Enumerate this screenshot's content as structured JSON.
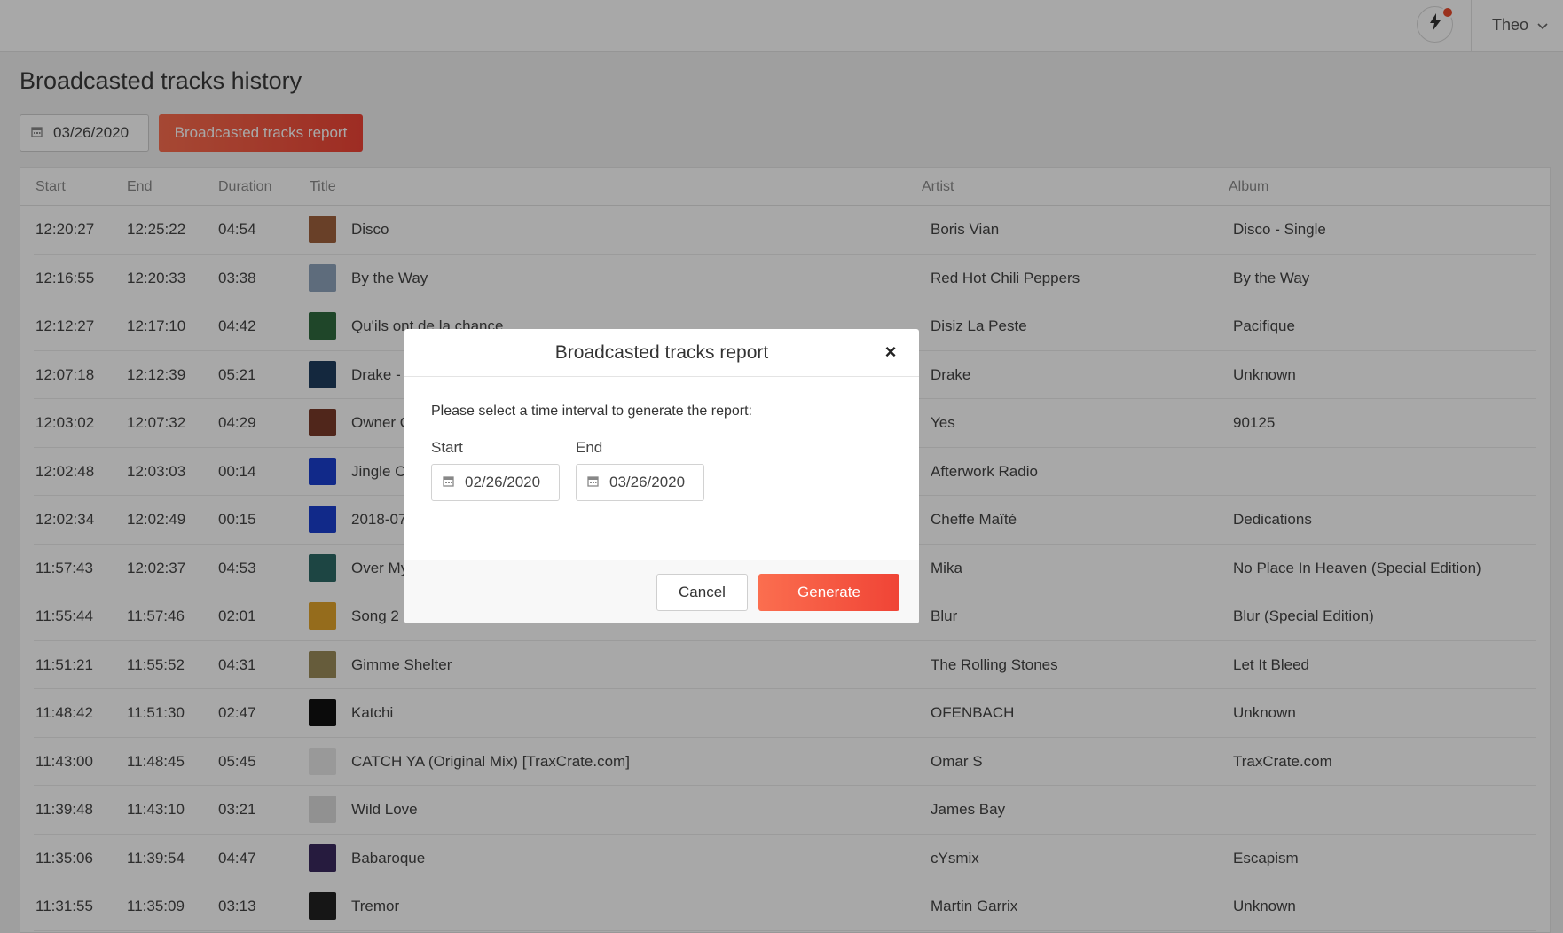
{
  "topbar": {
    "notifications_icon": "lightning-bolt-icon",
    "user_name": "Theo",
    "user_menu_icon": "chevron-down-icon"
  },
  "page": {
    "title": "Broadcasted tracks history",
    "date_filter": "03/26/2020",
    "report_button": "Broadcasted tracks report"
  },
  "table": {
    "headers": {
      "start": "Start",
      "end": "End",
      "duration": "Duration",
      "title": "Title",
      "artist": "Artist",
      "album": "Album"
    },
    "rows": [
      {
        "start": "12:20:27",
        "end": "12:25:22",
        "duration": "04:54",
        "title": "Disco",
        "artist": "Boris Vian",
        "album": "Disco - Single",
        "cover": "#a0623e"
      },
      {
        "start": "12:16:55",
        "end": "12:20:33",
        "duration": "03:38",
        "title": "By the Way",
        "artist": "Red Hot Chili Peppers",
        "album": "By the Way",
        "cover": "#8fa5bd"
      },
      {
        "start": "12:12:27",
        "end": "12:17:10",
        "duration": "04:42",
        "title": "Qu'ils ont de la chance",
        "artist": "Disiz La Peste",
        "album": "Pacifique",
        "cover": "#2f6b3f"
      },
      {
        "start": "12:07:18",
        "end": "12:12:39",
        "duration": "05:21",
        "title": "Drake - ",
        "artist": "Drake",
        "album": "Unknown",
        "cover": "#1f3d5e"
      },
      {
        "start": "12:03:02",
        "end": "12:07:32",
        "duration": "04:29",
        "title": "Owner Of",
        "artist": "Yes",
        "album": "90125",
        "cover": "#7a3a2a"
      },
      {
        "start": "12:02:48",
        "end": "12:03:03",
        "duration": "00:14",
        "title": "Jingle Ch",
        "artist": "Afterwork Radio",
        "album": "",
        "cover": "#1a3fd0"
      },
      {
        "start": "12:02:34",
        "end": "12:02:49",
        "duration": "00:15",
        "title": "2018-07",
        "artist": "Cheffe Maïté",
        "album": "Dedications",
        "cover": "#1a3fd0"
      },
      {
        "start": "11:57:43",
        "end": "12:02:37",
        "duration": "04:53",
        "title": "Over My",
        "artist": "Mika",
        "album": "No Place In Heaven (Special Edition)",
        "cover": "#2d6a66"
      },
      {
        "start": "11:55:44",
        "end": "11:57:46",
        "duration": "02:01",
        "title": "Song 2",
        "artist": "Blur",
        "album": "Blur (Special Edition)",
        "cover": "#e3a52b"
      },
      {
        "start": "11:51:21",
        "end": "11:55:52",
        "duration": "04:31",
        "title": "Gimme Shelter",
        "artist": "The Rolling Stones",
        "album": "Let It Bleed",
        "cover": "#9c8c5a"
      },
      {
        "start": "11:48:42",
        "end": "11:51:30",
        "duration": "02:47",
        "title": "Katchi",
        "artist": "OFENBACH",
        "album": "Unknown",
        "cover": "#111111"
      },
      {
        "start": "11:43:00",
        "end": "11:48:45",
        "duration": "05:45",
        "title": "CATCH YA (Original Mix) [TraxCrate.com]",
        "artist": "Omar S",
        "album": "TraxCrate.com",
        "cover": "#e8e8e8"
      },
      {
        "start": "11:39:48",
        "end": "11:43:10",
        "duration": "03:21",
        "title": "Wild Love",
        "artist": "James Bay",
        "album": "",
        "cover": "#dcdcdc"
      },
      {
        "start": "11:35:06",
        "end": "11:39:54",
        "duration": "04:47",
        "title": "Babaroque",
        "artist": "cYsmix",
        "album": "Escapism",
        "cover": "#3b2a5e"
      },
      {
        "start": "11:31:55",
        "end": "11:35:09",
        "duration": "03:13",
        "title": "Tremor",
        "artist": "Martin Garrix",
        "album": "Unknown",
        "cover": "#222222"
      }
    ]
  },
  "modal": {
    "title": "Broadcasted tracks report",
    "close_label": "×",
    "prompt": "Please select a time interval to generate the report:",
    "start_label": "Start",
    "start_value": "02/26/2020",
    "end_label": "End",
    "end_value": "03/26/2020",
    "cancel_label": "Cancel",
    "generate_label": "Generate"
  },
  "colors": {
    "accent": "#f04436",
    "accent_light": "#fb6e4f",
    "notification_dot": "#ea4b2d"
  }
}
